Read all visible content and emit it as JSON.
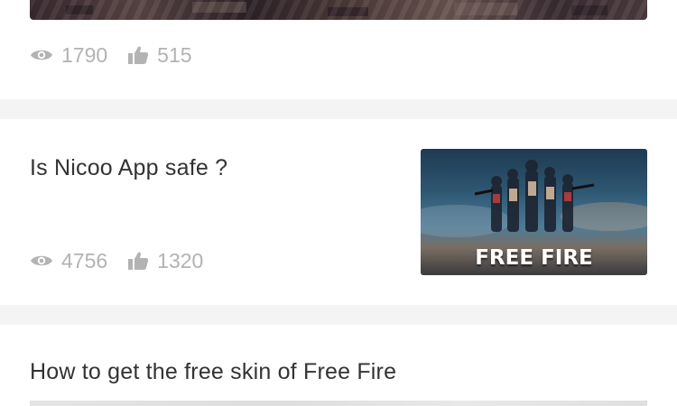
{
  "cards": [
    {
      "views": "1790",
      "likes": "515"
    },
    {
      "title": "Is Nicoo App safe ?",
      "views": "4756",
      "likes": "1320",
      "thumbnail_text": "FREE FIRE"
    },
    {
      "title": "How to get the free skin of Free Fire"
    }
  ],
  "colors": {
    "background": "#ffffff",
    "divider": "#f4f4f4",
    "title_text": "#333333",
    "stat_text": "#b3b3b3"
  },
  "icons": {
    "views": "eye-icon",
    "likes": "thumbs-up-icon"
  }
}
